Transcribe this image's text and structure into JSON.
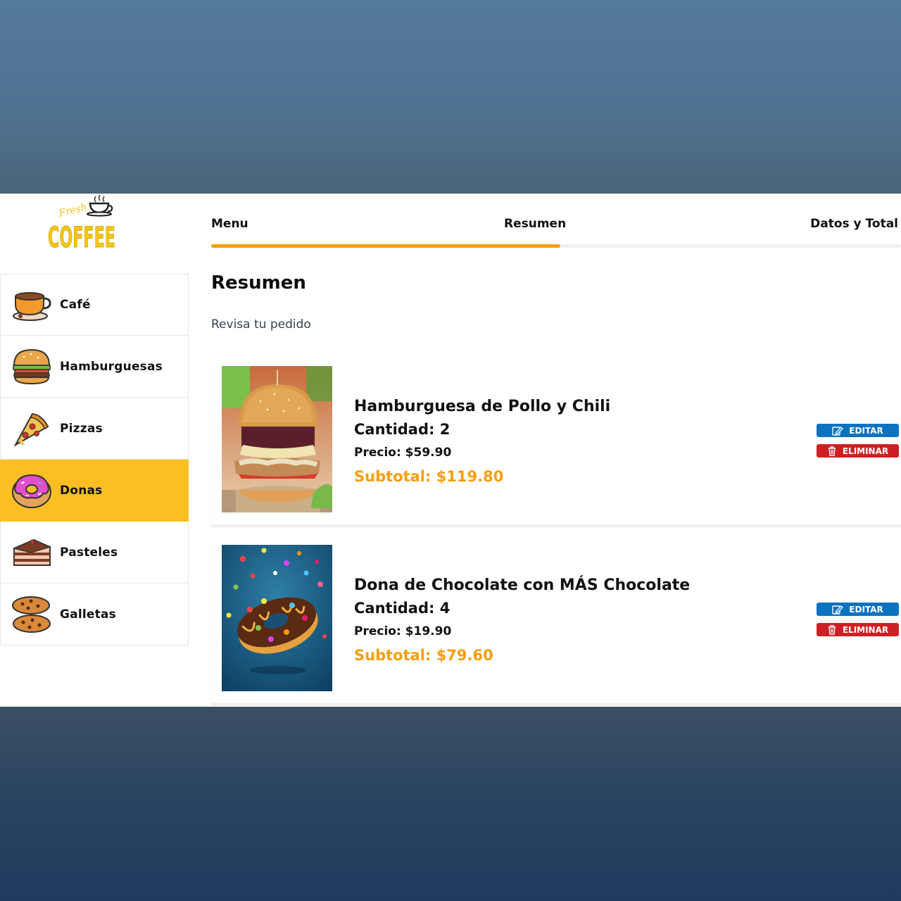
{
  "logo": {
    "script_text": "Fresh",
    "word_text": "COFFEE"
  },
  "steps": {
    "menu": "Menu",
    "resumen": "Resumen",
    "datos": "Datos y Total",
    "progress_fraction": 0.506
  },
  "sidebar": {
    "items": [
      {
        "label": "Café",
        "icon": "coffee-cup-icon",
        "active": false
      },
      {
        "label": "Hamburguesas",
        "icon": "burger-icon",
        "active": false
      },
      {
        "label": "Pizzas",
        "icon": "pizza-slice-icon",
        "active": false
      },
      {
        "label": "Donas",
        "icon": "donut-icon",
        "active": true
      },
      {
        "label": "Pasteles",
        "icon": "cake-slice-icon",
        "active": false
      },
      {
        "label": "Galletas",
        "icon": "cookies-icon",
        "active": false
      }
    ]
  },
  "main": {
    "title": "Resumen",
    "subtitle": "Revisa tu pedido"
  },
  "orders": [
    {
      "name": "Hamburguesa de Pollo y Chili",
      "quantity": "Cantidad: 2",
      "price": "Precio: $59.90",
      "subtotal": "Subtotal: $119.80",
      "image": "chicken-burger-photo"
    },
    {
      "name": "Dona de Chocolate con MÁS Chocolate",
      "quantity": "Cantidad: 4",
      "price": "Precio: $19.90",
      "subtotal": "Subtotal: $79.60",
      "image": "chocolate-donut-photo"
    }
  ],
  "buttons": {
    "edit": "EDITAR",
    "delete": "ELIMINAR"
  },
  "colors": {
    "accent": "#fbbf24",
    "progress": "#f59e0b",
    "subtotal": "#f59e0b",
    "edit": "#0b72c0",
    "delete": "#cf1f24"
  }
}
